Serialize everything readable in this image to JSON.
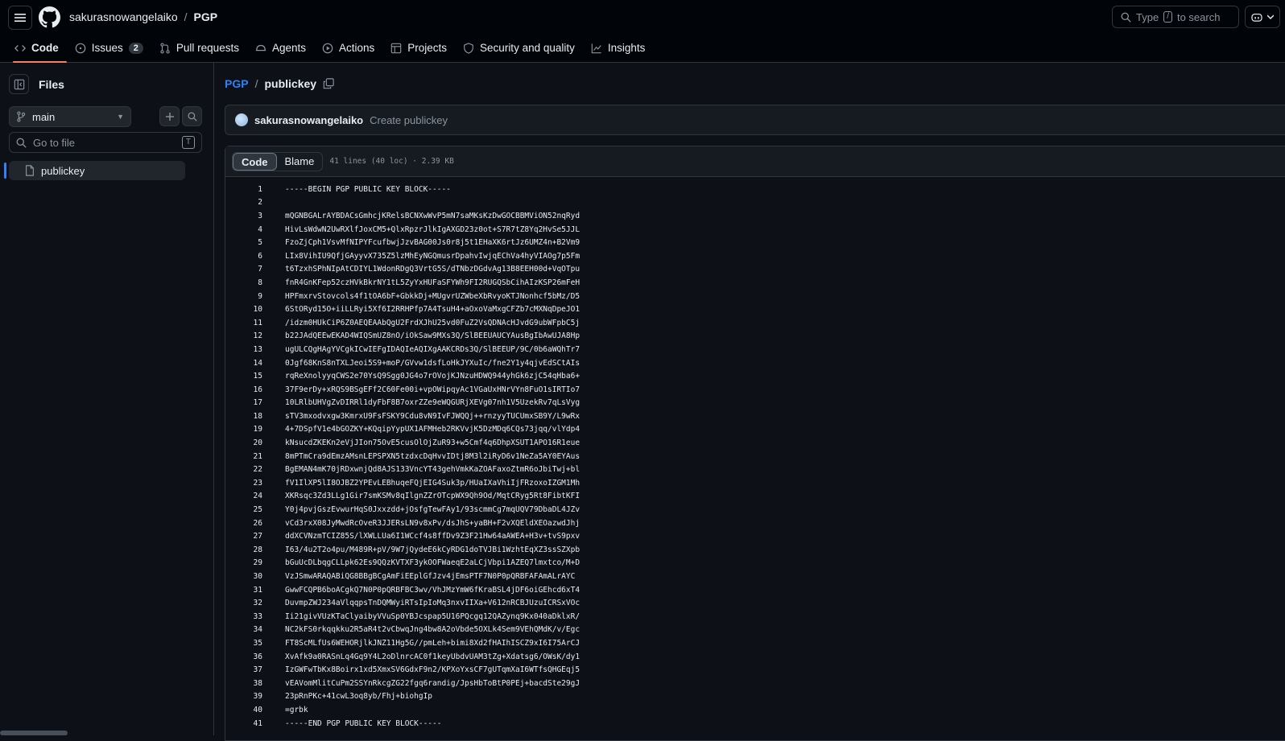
{
  "header": {
    "owner": "sakurasnowangelaiko",
    "separator": "/",
    "repo": "PGP",
    "search_prefix": "Type",
    "search_key": "/",
    "search_suffix": "to search"
  },
  "nav": {
    "items": [
      {
        "label": "Code",
        "icon": "code-icon"
      },
      {
        "label": "Issues",
        "icon": "issue-icon",
        "count": "2"
      },
      {
        "label": "Pull requests",
        "icon": "pull-request-icon"
      },
      {
        "label": "Agents",
        "icon": "agent-icon"
      },
      {
        "label": "Actions",
        "icon": "play-icon"
      },
      {
        "label": "Projects",
        "icon": "table-icon"
      },
      {
        "label": "Security and quality",
        "icon": "shield-icon"
      },
      {
        "label": "Insights",
        "icon": "graph-icon"
      }
    ]
  },
  "sidebar": {
    "title": "Files",
    "branch": "main",
    "goto_placeholder": "Go to file",
    "goto_key": "T",
    "files": [
      "publickey"
    ]
  },
  "main": {
    "path_root": "PGP",
    "path_sep": "/",
    "file_name": "publickey",
    "commit_user": "sakurasnowangelaiko",
    "commit_message": "Create publickey",
    "tab_code": "Code",
    "tab_blame": "Blame",
    "file_meta": "41 lines (40 loc) · 2.39 KB"
  },
  "code_lines": [
    "-----BEGIN PGP PUBLIC KEY BLOCK-----",
    "",
    "mQGNBGALrAYBDACsGmhcjKRelsBCNXwWvP5mN7saMKsKzDwGOCBBMViON52nqRyd",
    "HivLsWdwN2UwRXlfJoxCM5+QlxRpzrJlkIgAXGD23z0ot+S7R7tZ8Yq2HvSe5JJL",
    "FzoZjCph1VsvMfNIPYFcufbwjJzvBAG00Js0r8j5t1EHaXK6rtJz6UMZ4n+B2Vm9",
    "LIx8VihIU9QfjGAyyvX735Z5lzMhEyNGQmusrDpahvIwjqEChVa4hyVIAOg7p5Fm",
    "t6TzxhSPhNIpAtCDIYL1WdonRDgQ3VrtG5S/dTNbzDGdvAg13B8EEH00d+VqOTpu",
    "fnR4GnKFep52czHVkBkrNY1tL5ZyYxHUFaSFYWh9FI2RUGQSbCihAIzKSP26mFeH",
    "HPFmxrvStovcols4f1tOA6bF+GbkkDj+MUgvrUZWbeXbRvyoKTJNonhcf5bMz/D5",
    "6StORyd15O+iiLLRyi5Xf6I2RRHPfp7A4TsuH4+aOxoVaMxgCFZb7cMXNqDpeJO1",
    "/idzm0HUkCiP6Z0AEQEAAbQgU2FrdXJhU25vd0FuZ2VsQDNAcHJvdG9ubWFpbC5j",
    "b22JAdQEEwEKAD4WIQSmUZ8nO/iOkSaw9MXs3Q/SlBEEUAUCYAusBgIbAwUJA8Hp",
    "ugULCQgHAgYVCgkICwIEFgIDAQIeAQIXgAAKCRDs3Q/SlBEEUP/9C/0b6aWQhTr7",
    "0Jgf68KnS8nTXLJeoi5S9+moP/GVvw1dsfLoHkJYXuIc/fne2Y1y4qjvEdSCtAIs",
    "rqReXnolyyqCWS2e70YsQ9Sgg0JG4o7rOVojKJNzuHDWQ944yhGk6zjC54qHba6+",
    "37F9erDy+xRQS9BSgEFf2C60Fe00i+vpOWipqyAc1VGaUxHNrVYn8FuO1sIRTIo7",
    "10LRlbUHVgZvDIRRl1dyFbF8B7oxrZZe9eWQGURjXEVg07nh1V5UzekRv7qLsVyg",
    "sTV3mxodvxgw3KmrxU9FsFSKY9Cdu8vN9IvFJWQQj++rnzyyTUCUmxSB9Y/L9wRx",
    "4+7DSpfV1e4bGOZKY+KQqipYypUX1AFMHeb2RKVvjK5DzMDq6CQs73jqq/vlYdp4",
    "kNsucdZKEKn2eVjJIon75OvE5cusOlOjZuR93+w5Cmf4q6DhpXSUT1APO16R1eue",
    "8mPTmCra9dEmzAMsnLEPSPXN5tzdxcDqHvvIDtj8M3l2iRyD6v1NeZa5AY0EYAus",
    "BgEMAN4mK70jRDxwnjQd8AJS133VncYT43gehVmkKaZOAFaxoZtmR6oJbiTwj+bl",
    "fV1IlXP5lI8OJBZ2YPEvLEBhuqeFQjEIG4Suk3p/HUaIXaVhiIjFRzoxoIZGM1Mh",
    "XKRsqc3Zd3LLg1Gir7smKSMv8qIlgnZZrOTcpWX9Qh9Od/MqtCRyg5Rt8FibtKFI",
    "Y0j4pvjGszEvwurHqS0Jxxzdd+jOsfgTewFAy1/93scmmCg7mqUQV79DbaDL4JZv",
    "vCd3rxX08JyMwdRcOveR3JJERsLN9v8xPv/dsJhS+yaBH+F2vXQEldXEOazwdJhj",
    "ddXCVNzmTCIZ85S/lXWLLUa6I1WCcf4s8ffDv9Z3F21Hw64aAWEA+H3v+tvS9pxv",
    "I63/4u2T2o4pu/M489R+pV/9W7jQydeE6kCyRDG1doTVJBi1WzhtEqXZ3ssSZXpb",
    "bGuUcDLbqgCLLpk62Es9QQzKVTXF3ykOOFWaeqE2aLCjVbpi1AZEQ7lmxtco/M+D",
    "VzJSmwARAQABiQG8BBgBCgAmFiEEplGfJzv4jEmsPTF7N0P0pQRBFAFAmALrAYC",
    "GwwFCQPB6boACgkQ7N0P0pQRBFBC3wv/VhJMzYmW6fKraBSL4jDF6oiGEhcd6xT4",
    "DuvmpZWJ234aVlqqpsTnDQMWyiRTsIpIoMq3nxvIIXa+V612nRCBJUzuICRSxVOc",
    "Ii21givVUzKTaClyaibyVVuSp0YBJcspap5U16PQcgq12QAZynq9Kx040aDklxR/",
    "NC2kFS0rkqqkku2R5aR4t2vCbwqJng4bw8A2oVbde5OXLk4Sem9VEhQMdK/v/Egc",
    "FT8ScMLfUs6WEHORjlkJNZ11Hg5G//pmLeh+bimi8Xd2fHAIhISCZ9xI6I75ArCJ",
    "XvAfk9a0RASnLq4Gq9Y4L2oDlnrcAC0f1keyUbdvUAM3tZg+Xdatsg6/OWsK/dy1",
    "IzGWFwTbKx8Boirx1xd5XmxSV6GdxF9n2/KPXoYxsCF7gUTqmXaI6WTfsQHGEqj5",
    "vEAVomMlitCuPm2SSYnRkcgZG22fgq6randig/JpsHbToBtP0PEj+bacdSte29gJ",
    "23pRnPKc+41cwL3oq8yb/Fhj+biohgIp",
    "=grbk",
    "-----END PGP PUBLIC KEY BLOCK-----"
  ]
}
